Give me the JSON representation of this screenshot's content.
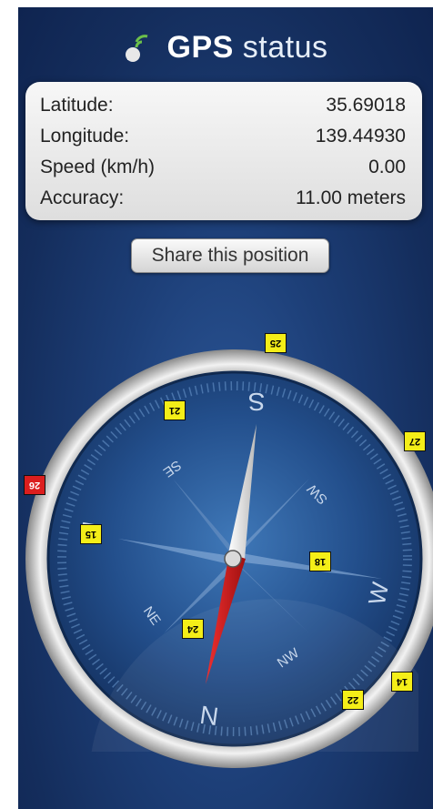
{
  "header": {
    "title_bold": "GPS",
    "title_light": "status",
    "logo_icon": "satellite-dish-icon"
  },
  "info": {
    "latitude": {
      "label": "Latitude:",
      "value": "35.69018"
    },
    "longitude": {
      "label": "Longitude:",
      "value": "139.44930"
    },
    "speed": {
      "label": "Speed (km/h)",
      "value": "0.00"
    },
    "accuracy": {
      "label": "Accuracy:",
      "value": "11.00 meters"
    }
  },
  "share_button": {
    "label": "Share this position"
  },
  "compass": {
    "labels": {
      "n": "N",
      "s": "S",
      "e": "E",
      "w": "W",
      "ne": "NE",
      "se": "SE",
      "sw": "SW",
      "nw": "NW"
    }
  },
  "satellites": [
    {
      "id": "25",
      "status": "locked"
    },
    {
      "id": "21",
      "status": "locked"
    },
    {
      "id": "27",
      "status": "locked"
    },
    {
      "id": "26",
      "status": "no-fix"
    },
    {
      "id": "15",
      "status": "locked"
    },
    {
      "id": "18",
      "status": "locked"
    },
    {
      "id": "24",
      "status": "locked"
    },
    {
      "id": "14",
      "status": "locked"
    },
    {
      "id": "22",
      "status": "locked"
    }
  ],
  "colors": {
    "satellite_locked": "#f4ee18",
    "satellite_no_fix": "#dc1e1e",
    "needle_north": "#d91a1a",
    "background": "#1d3f78"
  }
}
